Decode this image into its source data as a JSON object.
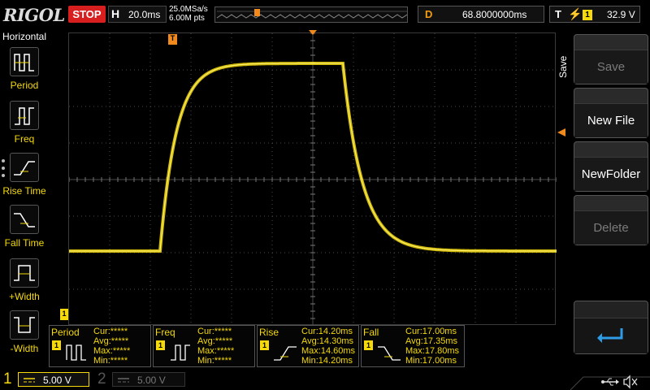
{
  "topbar": {
    "logo": "RIGOL",
    "run_state": "STOP",
    "horizontal_label": "H",
    "timebase": "20.0ms",
    "sample_rate": "25.0MSa/s",
    "memory_depth": "6.00M pts",
    "delay_label": "D",
    "delay_value": "68.8000000ms",
    "trigger_label": "T",
    "trigger_source": "1",
    "trigger_level": "32.9 V"
  },
  "left_menu": {
    "title": "Horizontal",
    "items": [
      {
        "label": "Period",
        "icon": "period-icon"
      },
      {
        "label": "Freq",
        "icon": "freq-icon"
      },
      {
        "label": "Rise Time",
        "icon": "rise-time-icon"
      },
      {
        "label": "Fall Time",
        "icon": "fall-time-icon"
      },
      {
        "label": "+Width",
        "icon": "positive-width-icon"
      },
      {
        "label": "-Width",
        "icon": "negative-width-icon"
      }
    ]
  },
  "measurements": [
    {
      "name": "Period",
      "channel": "1",
      "cur": "Cur:*****",
      "avg": "Avg:*****",
      "max": "Max:*****",
      "min": "Min:*****"
    },
    {
      "name": "Freq",
      "channel": "1",
      "cur": "Cur:*****",
      "avg": "Avg:*****",
      "max": "Max:*****",
      "min": "Min:*****"
    },
    {
      "name": "Rise",
      "channel": "1",
      "cur": "Cur:14.20ms",
      "avg": "Avg:14.30ms",
      "max": "Max:14.60ms",
      "min": "Min:14.20ms"
    },
    {
      "name": "Fall",
      "channel": "1",
      "cur": "Cur:17.00ms",
      "avg": "Avg:17.35ms",
      "max": "Max:17.80ms",
      "min": "Min:17.00ms"
    }
  ],
  "right_menu": {
    "tab_label": "Save",
    "buttons": [
      {
        "label": "Save",
        "enabled": false
      },
      {
        "label": "New File",
        "enabled": true
      },
      {
        "label": "NewFolder",
        "enabled": true
      },
      {
        "label": "Delete",
        "enabled": false
      }
    ],
    "back_icon": "enter-back-icon"
  },
  "channels": [
    {
      "number": "1",
      "scale": "5.00 V",
      "active": true
    },
    {
      "number": "2",
      "scale": "5.00 V",
      "active": false
    }
  ],
  "markers": {
    "trigger_pos": "T",
    "ch1_ground": "1"
  },
  "colors": {
    "ch1": "#f5d90a",
    "trigger": "#f08a1c",
    "stop": "#d81f1f",
    "grid": "#4a4a4a"
  },
  "status_icons": [
    "usb-icon",
    "speaker-mute-icon"
  ]
}
